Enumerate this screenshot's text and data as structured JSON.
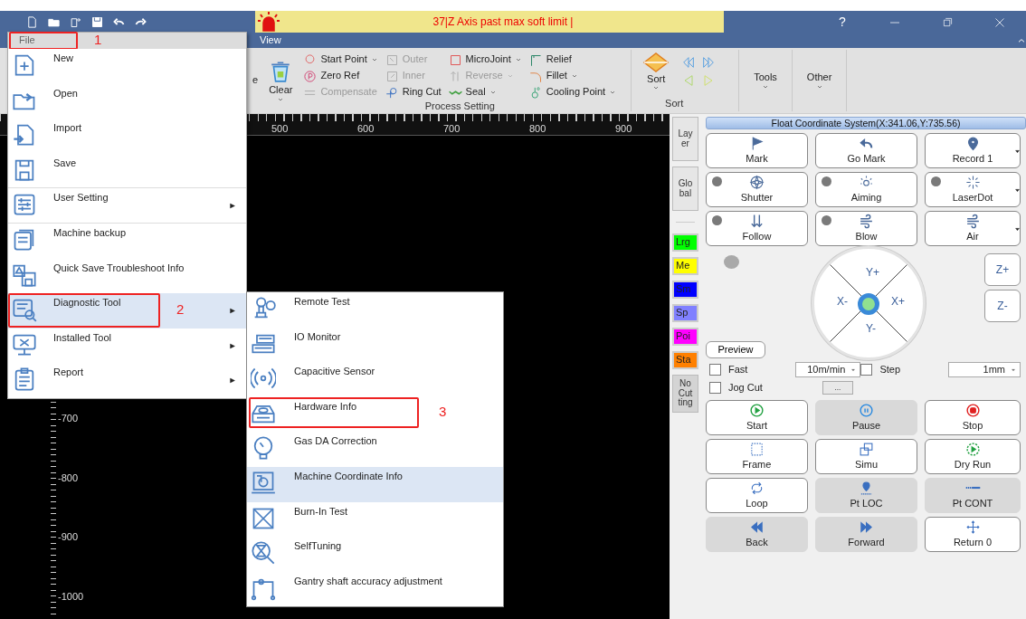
{
  "title_bar": {
    "alarm": "37|Z Axis past max soft limit |",
    "help": "?"
  },
  "menu_bar": {
    "tab": "View"
  },
  "ribbon": {
    "partial_label": "e",
    "clear": "Clear",
    "process_columns": [
      [
        {
          "label": "Start Point",
          "dropdown": true,
          "disabled": false
        },
        {
          "label": "Zero Ref",
          "dropdown": false,
          "disabled": false
        },
        {
          "label": "Compensate",
          "dropdown": false,
          "disabled": true
        }
      ],
      [
        {
          "label": "Outer",
          "dropdown": false,
          "disabled": true
        },
        {
          "label": "Inner",
          "dropdown": false,
          "disabled": true
        },
        {
          "label": "Ring Cut",
          "dropdown": false,
          "disabled": false
        }
      ],
      [
        {
          "label": "MicroJoint",
          "dropdown": true,
          "disabled": false
        },
        {
          "label": "Reverse",
          "dropdown": true,
          "disabled": true
        },
        {
          "label": "Seal",
          "dropdown": true,
          "disabled": false
        }
      ],
      [
        {
          "label": "Relief",
          "dropdown": false,
          "disabled": false
        },
        {
          "label": "Fillet",
          "dropdown": true,
          "disabled": false
        },
        {
          "label": "Cooling Point",
          "dropdown": true,
          "disabled": false
        }
      ]
    ],
    "process_group": "Process Setting",
    "sort_button": "Sort",
    "sort_group": "Sort",
    "tools": "Tools",
    "other": "Other"
  },
  "canvas": {
    "x_ticks": [
      "500",
      "600",
      "700",
      "800",
      "900"
    ],
    "y_ticks": [
      "-700",
      "-800",
      "-900",
      "-1000"
    ]
  },
  "file_menu": {
    "title": "File",
    "callout": "1",
    "items": [
      {
        "label": "New",
        "submenu": false,
        "selected": false,
        "divider": false
      },
      {
        "label": "Open",
        "submenu": false,
        "selected": false,
        "divider": false
      },
      {
        "label": "Import",
        "submenu": false,
        "selected": false,
        "divider": false
      },
      {
        "label": "Save",
        "submenu": false,
        "selected": false,
        "divider": true
      },
      {
        "label": "User Setting",
        "submenu": true,
        "selected": false,
        "divider": true
      },
      {
        "label": "Machine backup",
        "submenu": false,
        "selected": false,
        "divider": false
      },
      {
        "label": "Quick Save Troubleshoot Info",
        "submenu": false,
        "selected": false,
        "divider": false
      },
      {
        "label": "Diagnostic Tool",
        "submenu": true,
        "selected": true,
        "divider": false,
        "callout": "2"
      },
      {
        "label": "Installed Tool",
        "submenu": true,
        "selected": false,
        "divider": false
      },
      {
        "label": "Report",
        "submenu": true,
        "selected": false,
        "divider": false
      }
    ]
  },
  "submenu": {
    "items": [
      {
        "label": "Remote Test",
        "selected": false
      },
      {
        "label": "IO Monitor",
        "selected": false
      },
      {
        "label": "Capacitive Sensor",
        "selected": false
      },
      {
        "label": "Hardware Info",
        "selected": false,
        "callout": "3"
      },
      {
        "label": "Gas DA Correction",
        "selected": false
      },
      {
        "label": "Machine Coordinate Info",
        "selected": true
      },
      {
        "label": "Burn-In Test",
        "selected": false
      },
      {
        "label": "SelfTuning",
        "selected": false
      },
      {
        "label": "Gantry shaft accuracy adjustment",
        "selected": false
      }
    ]
  },
  "side_tabs": [
    {
      "kind": "button",
      "label": "Layer"
    },
    {
      "kind": "button",
      "label": "Global"
    },
    {
      "kind": "layer",
      "label": "Lrg",
      "color": "#00ff00"
    },
    {
      "kind": "layer",
      "label": "Me",
      "color": "#ffff00"
    },
    {
      "kind": "layer",
      "label": "Sm",
      "color": "#0000ff"
    },
    {
      "kind": "layer",
      "label": "Sp",
      "color": "#8080ff"
    },
    {
      "kind": "layer",
      "label": "Poi",
      "color": "#ff00ff"
    },
    {
      "kind": "layer",
      "label": "Sta",
      "color": "#ff8000"
    },
    {
      "kind": "status",
      "label": "No Cutting"
    }
  ],
  "coordinate_system": "Float Coordinate System(X:341.06,Y:735.56)",
  "quick_buttons": [
    {
      "label": "Mark",
      "lamp": false,
      "dropdown": false
    },
    {
      "label": "Go Mark",
      "lamp": false,
      "dropdown": false
    },
    {
      "label": "Record 1",
      "lamp": false,
      "dropdown": true
    },
    {
      "label": "Shutter",
      "lamp": true,
      "dropdown": false
    },
    {
      "label": "Aiming",
      "lamp": true,
      "dropdown": false
    },
    {
      "label": "LaserDot",
      "lamp": true,
      "dropdown": true
    },
    {
      "label": "Follow",
      "lamp": true,
      "dropdown": false
    },
    {
      "label": "Blow",
      "lamp": true,
      "dropdown": false
    },
    {
      "label": "Air",
      "lamp": false,
      "dropdown": true
    }
  ],
  "jog": {
    "up": "Y+",
    "left": "X-",
    "right": "X+",
    "down": "Y-",
    "z_up": "Z+",
    "z_down": "Z-",
    "preview": "Preview",
    "fast": {
      "label": "Fast",
      "checked": false
    },
    "speed": "10m/min",
    "step": {
      "label": "Step",
      "checked": false
    },
    "step_size": "1mm",
    "jog_cut": {
      "label": "Jog Cut",
      "checked": false
    },
    "more": "..."
  },
  "run_buttons": [
    {
      "label": "Start",
      "disabled": false
    },
    {
      "label": "Pause",
      "disabled": true
    },
    {
      "label": "Stop",
      "disabled": false
    },
    {
      "label": "Frame",
      "disabled": false
    },
    {
      "label": "Simu",
      "disabled": false
    },
    {
      "label": "Dry Run",
      "disabled": false
    },
    {
      "label": "Loop",
      "disabled": false
    },
    {
      "label": "Pt LOC",
      "disabled": true
    },
    {
      "label": "Pt CONT",
      "disabled": true
    },
    {
      "label": "Back",
      "disabled": true
    },
    {
      "label": "Forward",
      "disabled": true
    },
    {
      "label": "Return 0",
      "disabled": false
    }
  ]
}
